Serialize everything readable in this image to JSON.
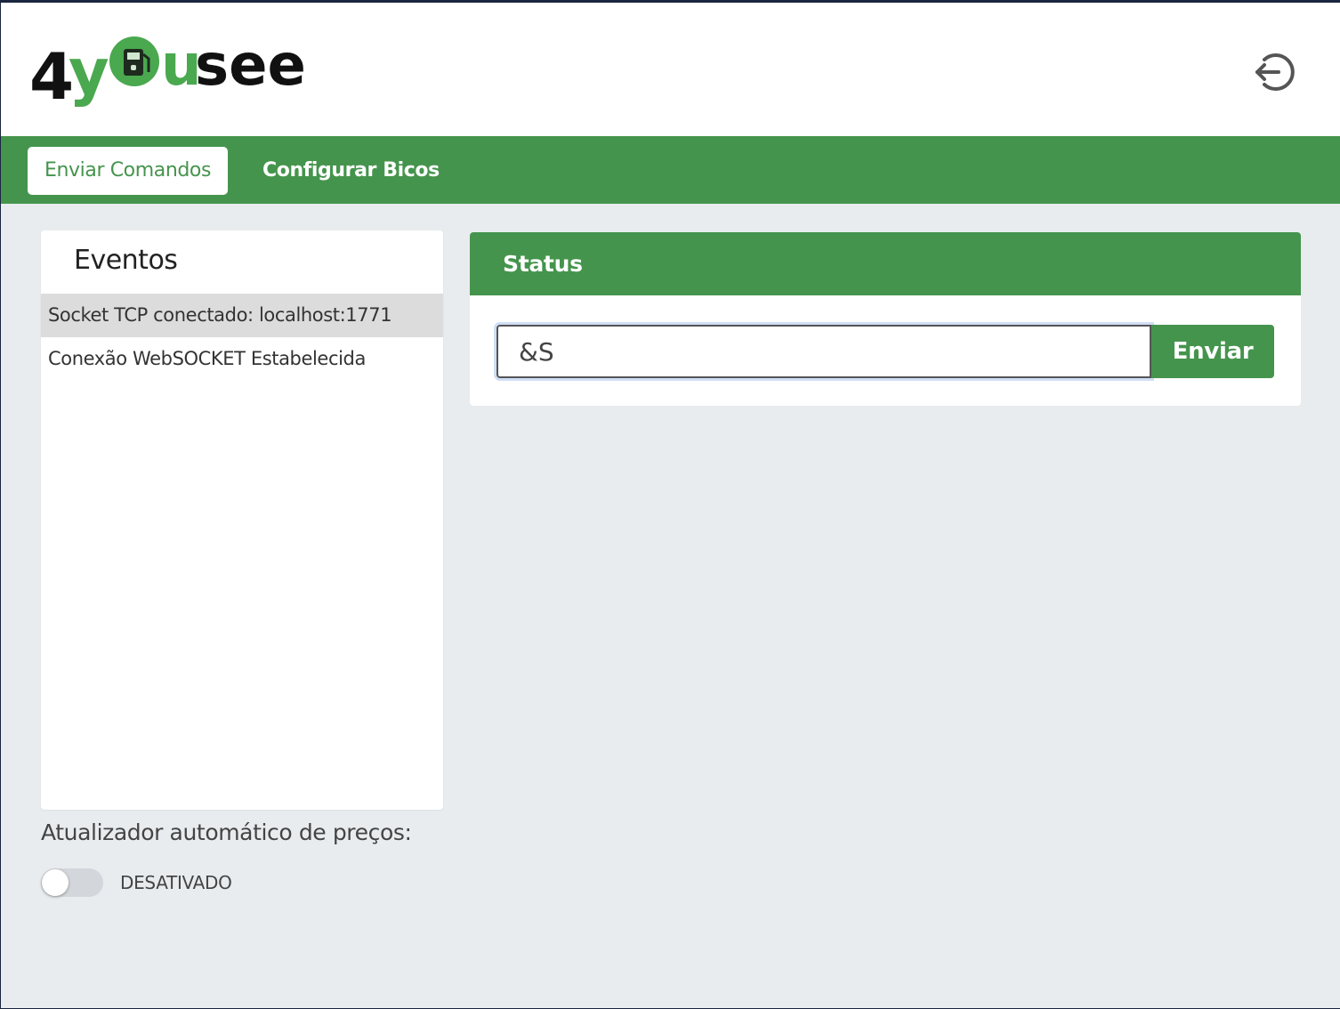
{
  "brand": {
    "logo_text": "4yousee",
    "accent_color": "#45944d",
    "icon": "fuel-pump-icon"
  },
  "header": {
    "logout_icon": "logout-icon"
  },
  "tabs": [
    {
      "label": "Enviar Comandos",
      "active": true
    },
    {
      "label": "Configurar Bicos",
      "active": false
    }
  ],
  "events": {
    "title": "Eventos",
    "items": [
      {
        "text": "Socket TCP conectado: localhost:1771",
        "selected": true
      },
      {
        "text": "Conexão WebSOCKET Estabelecida",
        "selected": false
      }
    ]
  },
  "auto_price": {
    "label": "Atualizador automático de preços:",
    "toggle_on": false,
    "state_label": "DESATIVADO"
  },
  "status": {
    "title": "Status",
    "command_value": "&S",
    "send_label": "Enviar"
  }
}
